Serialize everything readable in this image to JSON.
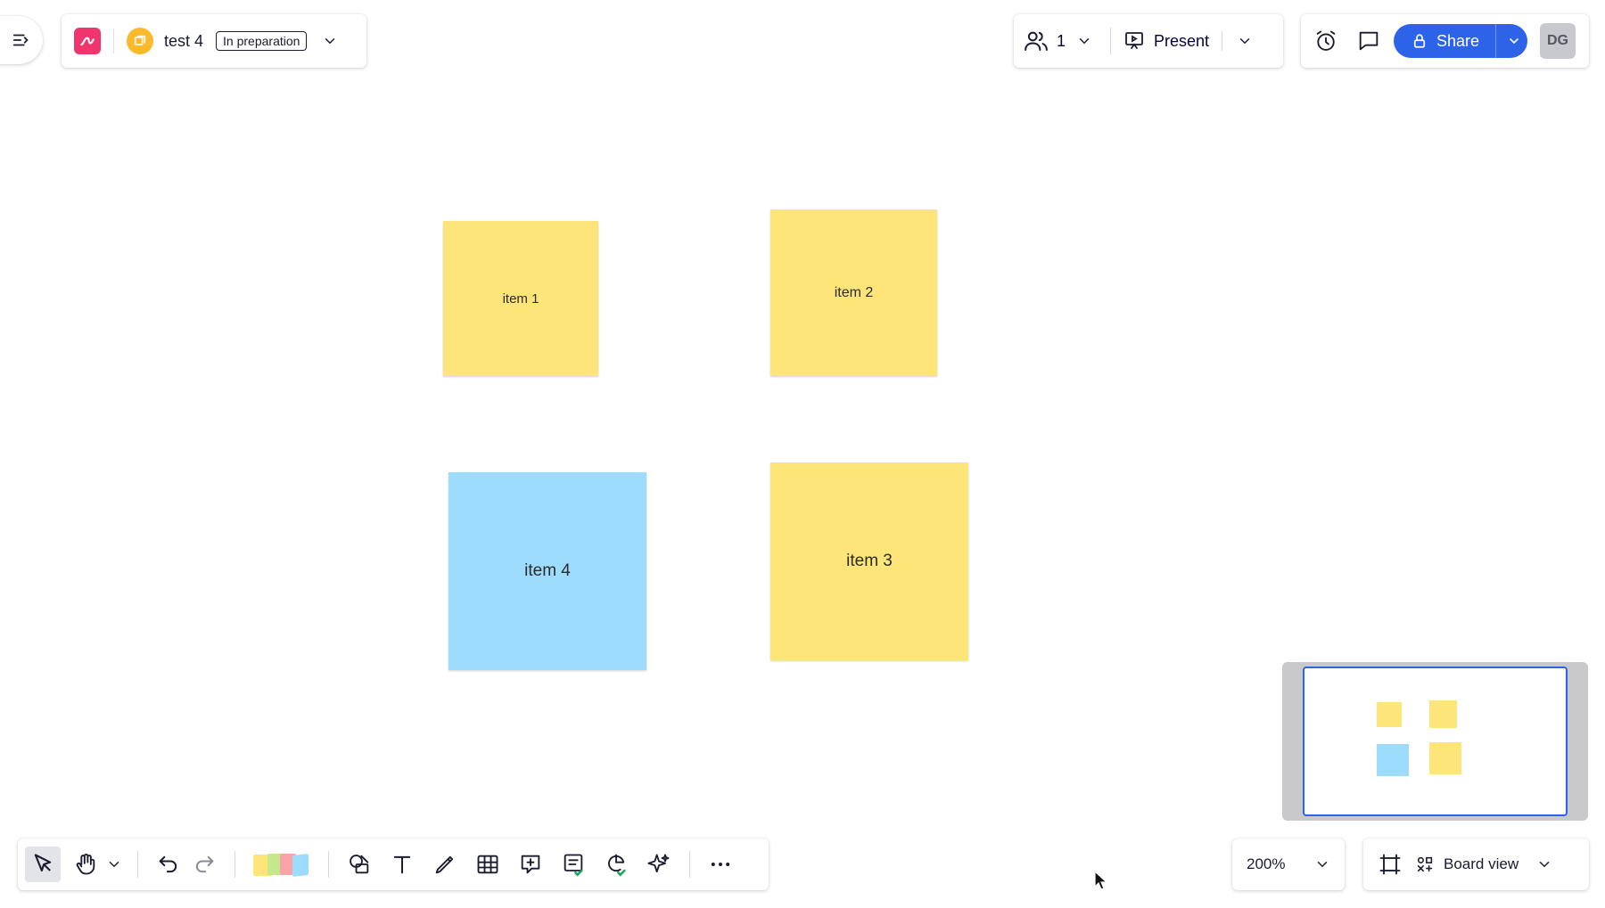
{
  "header": {
    "board_title": "test 4",
    "status_badge": "In preparation"
  },
  "collab": {
    "user_count": "1",
    "present_label": "Present"
  },
  "actions": {
    "share_label": "Share",
    "avatar_initials": "DG"
  },
  "canvas": {
    "stickies": [
      {
        "label": "item 1",
        "color": "#fee579"
      },
      {
        "label": "item 2",
        "color": "#fee579"
      },
      {
        "label": "item 3",
        "color": "#fee579"
      },
      {
        "label": "item 4",
        "color": "#9ddcfc"
      }
    ]
  },
  "zoom": {
    "level": "200%"
  },
  "view": {
    "board_view_label": "Board view"
  },
  "colors": {
    "accent": "#2c63e8",
    "brand": "#f0346e",
    "badge_orange": "#fdb92c",
    "sticky_yellow": "#fee579",
    "sticky_blue": "#9ddcfc"
  }
}
